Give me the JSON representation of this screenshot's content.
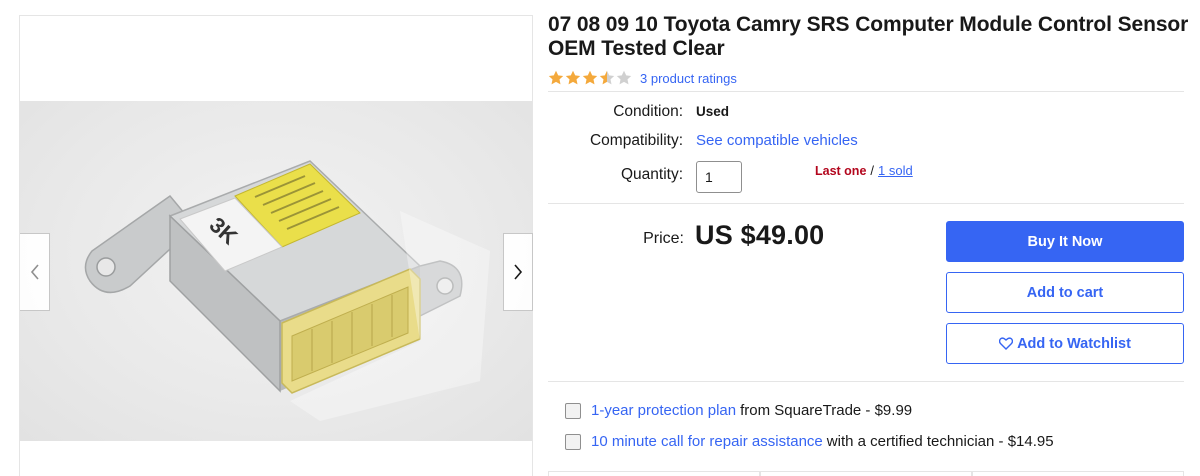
{
  "listing": {
    "title": "07 08 09 10 Toyota Camry SRS Computer Module Control Sensor OEM Tested Clear",
    "rating": {
      "stars": 3.5,
      "max": 5,
      "ratings_text": "3 product ratings"
    }
  },
  "gallery": {
    "module_label": "3K",
    "prev_icon": "chevron-left-icon",
    "next_icon": "chevron-right-icon"
  },
  "details": {
    "condition_label": "Condition:",
    "condition_value": "Used",
    "compat_label": "Compatibility:",
    "compat_link": "See compatible vehicles",
    "quantity_label": "Quantity:",
    "quantity_value": "1",
    "stock_last": "Last one",
    "stock_sep": "/",
    "stock_sold": "1 sold"
  },
  "purchase": {
    "price_label": "Price:",
    "price": "US $49.00",
    "buy_now": "Buy It Now",
    "add_cart": "Add to cart",
    "watchlist": "Add to Watchlist"
  },
  "addons": [
    {
      "link": "1-year protection plan",
      "text": "from SquareTrade - $9.99"
    },
    {
      "link": "10 minute call for repair assistance",
      "text": "with a certified technician - $14.95"
    }
  ],
  "colors": {
    "accent": "#3665f3",
    "star": "#f4a93c",
    "urgent": "#b3061d"
  }
}
